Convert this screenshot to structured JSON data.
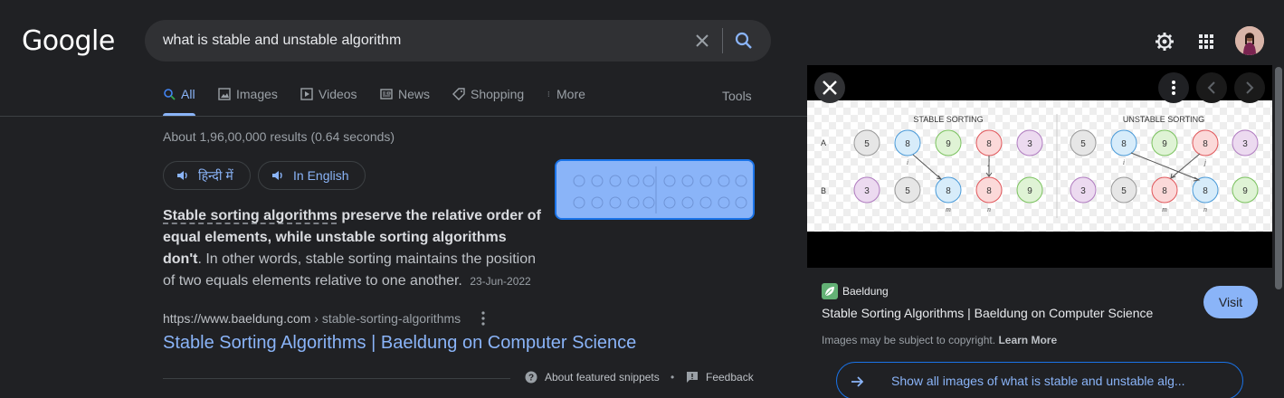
{
  "header": {
    "logo": "Google",
    "search_value": "what is stable and unstable algorithm"
  },
  "tabs": {
    "items": [
      {
        "label": "All",
        "icon": "search-icon",
        "active": true
      },
      {
        "label": "Images",
        "icon": "image-icon"
      },
      {
        "label": "Videos",
        "icon": "play-icon"
      },
      {
        "label": "News",
        "icon": "news-icon"
      },
      {
        "label": "Shopping",
        "icon": "tag-icon"
      },
      {
        "label": "More",
        "icon": "more-vertical-icon"
      }
    ],
    "tools": "Tools"
  },
  "result_stats": "About 1,96,00,000 results (0.64 seconds)",
  "language_buttons": {
    "hindi": "हिन्दी में",
    "english": "In English"
  },
  "snippet": {
    "highlight": "Stable sorting algorithms",
    "bold_rest": " preserve the relative order of equal elements, while unstable sorting algorithms don't",
    "plain": ". In other words, stable sorting maintains the position of two equals elements relative to one another.",
    "date": "23-Jun-2022"
  },
  "result": {
    "cite_domain": "https://www.baeldung.com",
    "cite_path": " › stable-sorting-algorithms",
    "title": "Stable Sorting Algorithms | Baeldung on Computer Science"
  },
  "footer": {
    "about": "About featured snippets",
    "dot": "•",
    "feedback": "Feedback"
  },
  "panel": {
    "image_title_left": "STABLE SORTING",
    "image_title_right": "UNSTABLE SORTING",
    "row_a_label": "A",
    "row_b_label": "B",
    "source": "Baeldung",
    "title": "Stable Sorting Algorithms | Baeldung on Computer Science",
    "visit": "Visit",
    "copyright": "Images may be subject to copyright.",
    "learn_more": "Learn More",
    "show_all": "Show all images of what is stable and unstable alg..."
  },
  "colors": {
    "background": "#202124",
    "link": "#8ab4f8",
    "accent": "#1a73e8"
  }
}
